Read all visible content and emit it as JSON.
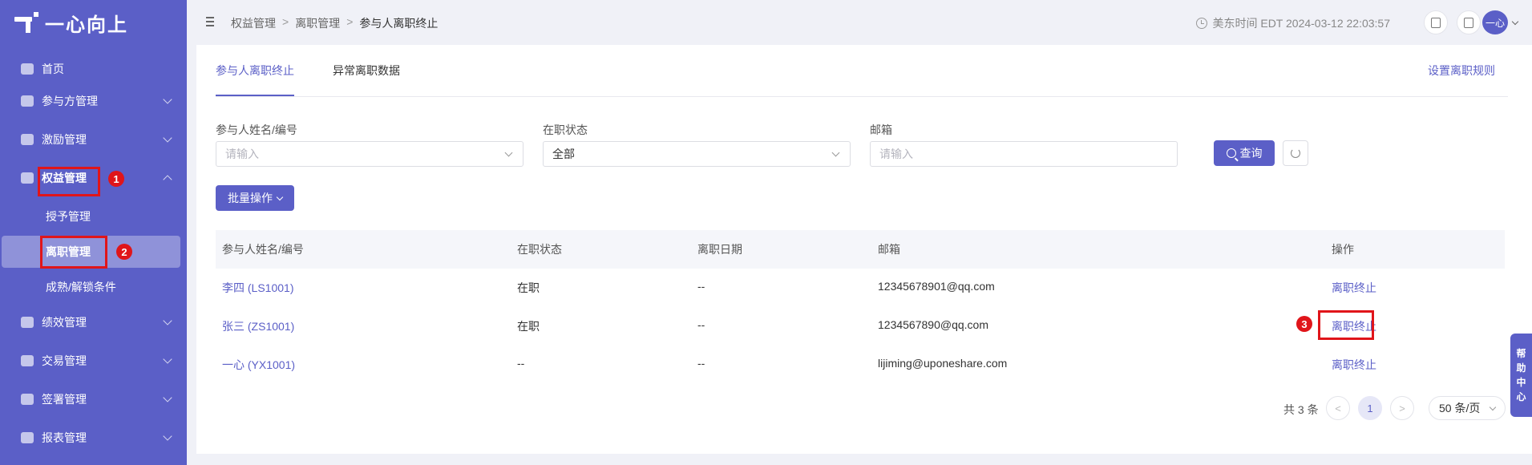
{
  "app": {
    "logo_text": "一心向上"
  },
  "sidebar": {
    "items": [
      {
        "label": "首页",
        "icon": "home-icon"
      },
      {
        "label": "参与方管理",
        "icon": "participants-icon"
      },
      {
        "label": "激励管理",
        "icon": "incentive-icon"
      },
      {
        "label": "权益管理",
        "icon": "equity-icon",
        "expanded": true,
        "children": [
          {
            "label": "授予管理"
          },
          {
            "label": "离职管理",
            "active": true
          },
          {
            "label": "成熟/解锁条件"
          }
        ]
      },
      {
        "label": "绩效管理",
        "icon": "performance-icon"
      },
      {
        "label": "交易管理",
        "icon": "trade-icon"
      },
      {
        "label": "签署管理",
        "icon": "sign-icon"
      },
      {
        "label": "报表管理",
        "icon": "report-icon"
      }
    ]
  },
  "annotations": [
    "1",
    "2",
    "3"
  ],
  "header": {
    "breadcrumb": [
      "权益管理",
      "离职管理",
      "参与人离职终止"
    ],
    "time": "美东时间 EDT 2024-03-12 22:03:57",
    "avatar_text": "一心"
  },
  "tabs": [
    {
      "label": "参与人离职终止",
      "active": true
    },
    {
      "label": "异常离职数据",
      "active": false
    }
  ],
  "settings_link": "设置离职规则",
  "filters": {
    "name": {
      "label": "参与人姓名/编号",
      "placeholder": "请输入"
    },
    "status": {
      "label": "在职状态",
      "value": "全部"
    },
    "email": {
      "label": "邮箱",
      "placeholder": "请输入"
    },
    "query_label": "查询"
  },
  "batch_label": "批量操作",
  "table": {
    "columns": [
      "参与人姓名/编号",
      "在职状态",
      "离职日期",
      "邮箱",
      "操作"
    ],
    "rows": [
      {
        "name": "李四 (LS1001)",
        "status": "在职",
        "date": "--",
        "email": "12345678901@qq.com",
        "action": "离职终止"
      },
      {
        "name": "张三 (ZS1001)",
        "status": "在职",
        "date": "--",
        "email": "1234567890@qq.com",
        "action": "离职终止"
      },
      {
        "name": "一心 (YX1001)",
        "status": "--",
        "date": "--",
        "email": "lijiming@uponeshare.com",
        "action": "离职终止"
      }
    ]
  },
  "pagination": {
    "total": "共 3 条",
    "prev": "<",
    "current": "1",
    "next": ">",
    "page_size": "50 条/页"
  },
  "help": [
    "帮",
    "助",
    "中",
    "心"
  ],
  "colors": {
    "brand": "#5b5fc7",
    "highlight": "#e0151a"
  }
}
